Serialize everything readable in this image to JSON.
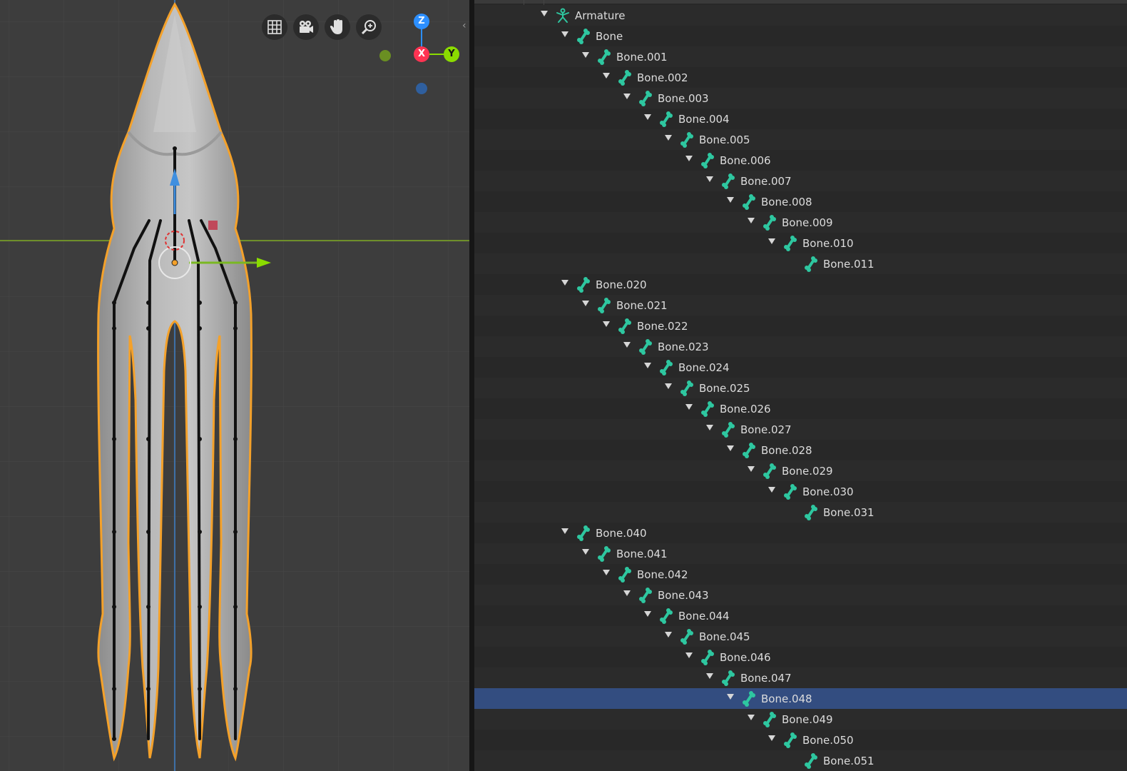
{
  "viewport": {
    "nav_buttons": [
      {
        "icon": "grid-icon"
      },
      {
        "icon": "camera-icon"
      },
      {
        "icon": "hand-pan-icon"
      },
      {
        "icon": "zoom-icon"
      }
    ],
    "gizmo": {
      "z_label": "Z",
      "x_label": "X",
      "y_label": "Y"
    },
    "colors": {
      "z": "#2c8fff",
      "x": "#ff3352",
      "y": "#8bdc00",
      "selection": "#f4a12a",
      "bone": "#111111"
    }
  },
  "outliner": {
    "accent_color": "#2ec7a0",
    "selected_color": "#334d80",
    "rows": [
      {
        "label": "Armature",
        "depth": 0,
        "expanded": true,
        "type": "armature"
      },
      {
        "label": "Bone",
        "depth": 1,
        "expanded": true,
        "type": "bone"
      },
      {
        "label": "Bone.001",
        "depth": 2,
        "expanded": true,
        "type": "bone"
      },
      {
        "label": "Bone.002",
        "depth": 3,
        "expanded": true,
        "type": "bone"
      },
      {
        "label": "Bone.003",
        "depth": 4,
        "expanded": true,
        "type": "bone"
      },
      {
        "label": "Bone.004",
        "depth": 5,
        "expanded": true,
        "type": "bone"
      },
      {
        "label": "Bone.005",
        "depth": 6,
        "expanded": true,
        "type": "bone"
      },
      {
        "label": "Bone.006",
        "depth": 7,
        "expanded": true,
        "type": "bone"
      },
      {
        "label": "Bone.007",
        "depth": 8,
        "expanded": true,
        "type": "bone"
      },
      {
        "label": "Bone.008",
        "depth": 9,
        "expanded": true,
        "type": "bone"
      },
      {
        "label": "Bone.009",
        "depth": 10,
        "expanded": true,
        "type": "bone"
      },
      {
        "label": "Bone.010",
        "depth": 11,
        "expanded": true,
        "type": "bone"
      },
      {
        "label": "Bone.011",
        "depth": 12,
        "expanded": false,
        "type": "bone"
      },
      {
        "label": "Bone.020",
        "depth": 1,
        "expanded": true,
        "type": "bone"
      },
      {
        "label": "Bone.021",
        "depth": 2,
        "expanded": true,
        "type": "bone"
      },
      {
        "label": "Bone.022",
        "depth": 3,
        "expanded": true,
        "type": "bone"
      },
      {
        "label": "Bone.023",
        "depth": 4,
        "expanded": true,
        "type": "bone"
      },
      {
        "label": "Bone.024",
        "depth": 5,
        "expanded": true,
        "type": "bone"
      },
      {
        "label": "Bone.025",
        "depth": 6,
        "expanded": true,
        "type": "bone"
      },
      {
        "label": "Bone.026",
        "depth": 7,
        "expanded": true,
        "type": "bone"
      },
      {
        "label": "Bone.027",
        "depth": 8,
        "expanded": true,
        "type": "bone"
      },
      {
        "label": "Bone.028",
        "depth": 9,
        "expanded": true,
        "type": "bone"
      },
      {
        "label": "Bone.029",
        "depth": 10,
        "expanded": true,
        "type": "bone"
      },
      {
        "label": "Bone.030",
        "depth": 11,
        "expanded": true,
        "type": "bone"
      },
      {
        "label": "Bone.031",
        "depth": 12,
        "expanded": false,
        "type": "bone"
      },
      {
        "label": "Bone.040",
        "depth": 1,
        "expanded": true,
        "type": "bone"
      },
      {
        "label": "Bone.041",
        "depth": 2,
        "expanded": true,
        "type": "bone"
      },
      {
        "label": "Bone.042",
        "depth": 3,
        "expanded": true,
        "type": "bone"
      },
      {
        "label": "Bone.043",
        "depth": 4,
        "expanded": true,
        "type": "bone"
      },
      {
        "label": "Bone.044",
        "depth": 5,
        "expanded": true,
        "type": "bone"
      },
      {
        "label": "Bone.045",
        "depth": 6,
        "expanded": true,
        "type": "bone"
      },
      {
        "label": "Bone.046",
        "depth": 7,
        "expanded": true,
        "type": "bone"
      },
      {
        "label": "Bone.047",
        "depth": 8,
        "expanded": true,
        "type": "bone"
      },
      {
        "label": "Bone.048",
        "depth": 9,
        "expanded": true,
        "type": "bone",
        "selected": true
      },
      {
        "label": "Bone.049",
        "depth": 10,
        "expanded": true,
        "type": "bone"
      },
      {
        "label": "Bone.050",
        "depth": 11,
        "expanded": true,
        "type": "bone"
      },
      {
        "label": "Bone.051",
        "depth": 12,
        "expanded": false,
        "type": "bone"
      }
    ]
  }
}
